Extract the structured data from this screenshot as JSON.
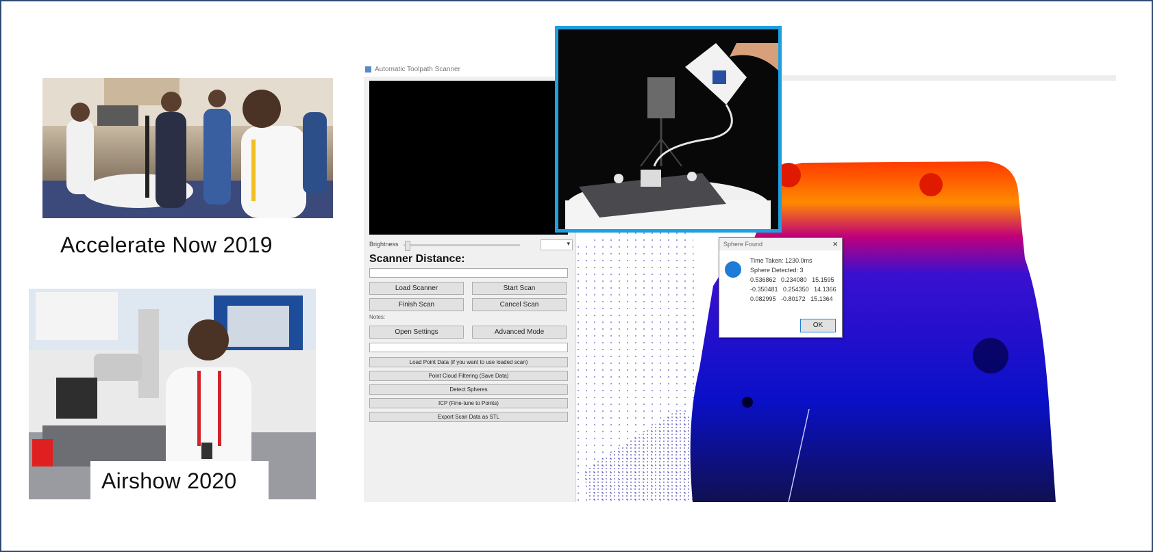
{
  "captions": {
    "event1": "Accelerate Now 2019",
    "event2": "Airshow 2020"
  },
  "colors": {
    "frame_border": "#2f4a74",
    "inset_border": "#1ea0e0",
    "scan_near": "#ff3a00",
    "scan_far": "#0000cc"
  },
  "app": {
    "window_title": "Automatic Toolpath Scanner",
    "brightness_label": "Brightness",
    "section_title": "Scanner Distance:",
    "buttons": {
      "load_scanner": "Load Scanner",
      "start_scan": "Start Scan",
      "finish_scan": "Finish Scan",
      "cancel_scan": "Cancel Scan",
      "open_settings": "Open Settings",
      "advanced_mode": "Advanced Mode",
      "wide1": "Load Point Data (if you want to use loaded scan)",
      "wide2": "Point Cloud Filtering (Save Data)",
      "wide3": "Detect Spheres",
      "wide4": "ICP (Fine-tune to Points)",
      "wide5": "Export Scan Data as STL"
    },
    "notes_label": "Notes:",
    "dialog": {
      "title": "Sphere Found",
      "close": "×",
      "lines": [
        "Time Taken: 1230.0ms",
        "Sphere Detected: 3",
        "0.536862   0.234080   15.1595",
        "-0.350481   0.254350   14.1366",
        "0.082995   -0.80172   15.1364"
      ],
      "ok": "OK"
    }
  },
  "icons": {
    "dialog_icon": "info-icon",
    "close": "close-icon"
  }
}
